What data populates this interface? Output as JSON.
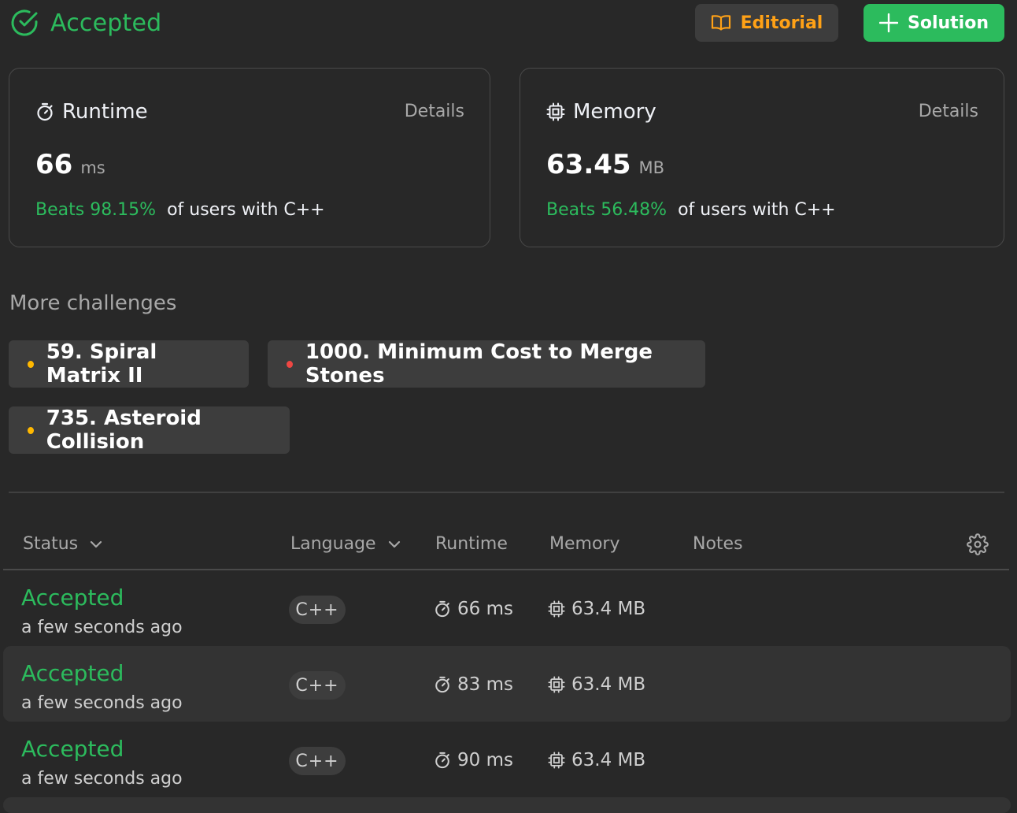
{
  "header": {
    "status": "Accepted",
    "editorial_label": "Editorial",
    "solution_label": "Solution"
  },
  "runtime_card": {
    "title": "Runtime",
    "details": "Details",
    "value": "66",
    "unit": "ms",
    "beats": "Beats 98.15%",
    "beats_suffix": "of users with C++"
  },
  "memory_card": {
    "title": "Memory",
    "details": "Details",
    "value": "63.45",
    "unit": "MB",
    "beats": "Beats 56.48%",
    "beats_suffix": "of users with C++"
  },
  "more_challenges": {
    "title": "More challenges",
    "items": [
      {
        "label": "59. Spiral Matrix II",
        "difficulty_color": "#ffb800"
      },
      {
        "label": "1000. Minimum Cost to Merge Stones",
        "difficulty_color": "#ef4743"
      },
      {
        "label": "735. Asteroid Collision",
        "difficulty_color": "#ffb800"
      }
    ]
  },
  "table": {
    "headers": {
      "status": "Status",
      "language": "Language",
      "runtime": "Runtime",
      "memory": "Memory",
      "notes": "Notes"
    },
    "rows": [
      {
        "status": "Accepted",
        "time": "a few seconds ago",
        "language": "C++",
        "runtime": "66 ms",
        "memory": "63.4 MB"
      },
      {
        "status": "Accepted",
        "time": "a few seconds ago",
        "language": "C++",
        "runtime": "83 ms",
        "memory": "63.4 MB"
      },
      {
        "status": "Accepted",
        "time": "a few seconds ago",
        "language": "C++",
        "runtime": "90 ms",
        "memory": "63.4 MB"
      }
    ]
  },
  "colors": {
    "accent_green": "#2cbb5d",
    "editorial_orange": "#ffa116",
    "medium": "#ffb800",
    "hard": "#ef4743"
  },
  "icons": [
    "check-circle-icon",
    "book-icon",
    "plus-icon",
    "stopwatch-icon",
    "chip-icon",
    "chevron-down-icon",
    "gear-icon"
  ]
}
